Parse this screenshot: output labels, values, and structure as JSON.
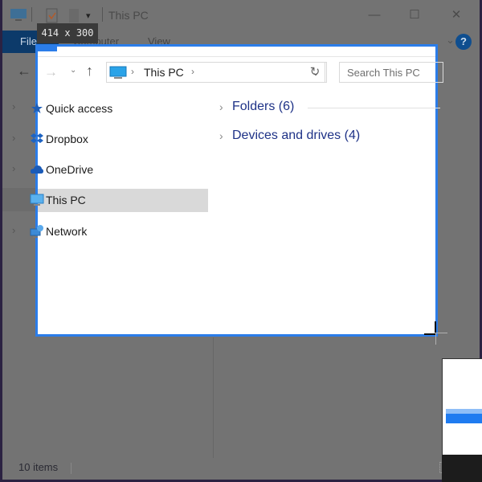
{
  "window": {
    "title": "This PC",
    "controls": {
      "minimize": "—",
      "maximize": "☐",
      "close": "✕"
    }
  },
  "ribbon": {
    "tabs": [
      "File",
      "Computer",
      "View"
    ],
    "help": "?"
  },
  "size_tooltip": "414 x 300",
  "address_bar": {
    "path": "This PC",
    "separator": "›",
    "dropdown": "⌄",
    "refresh": "↻"
  },
  "nav": {
    "back": "←",
    "forward": "→",
    "recent": "⌄",
    "up": "↑"
  },
  "search": {
    "placeholder": "Search This PC"
  },
  "sidebar": {
    "expand_glyph": "›",
    "items": [
      {
        "label": "Quick access",
        "icon": "star-icon"
      },
      {
        "label": "Dropbox",
        "icon": "dropbox-icon"
      },
      {
        "label": "OneDrive",
        "icon": "cloud-icon"
      },
      {
        "label": "This PC",
        "icon": "computer-icon",
        "selected": true
      },
      {
        "label": "Network",
        "icon": "network-icon"
      }
    ]
  },
  "content": {
    "groups": [
      {
        "label": "Folders (6)"
      },
      {
        "label": "Devices and drives (4)"
      }
    ]
  },
  "status_bar": {
    "items_count": "10 items"
  },
  "colors": {
    "accent": "#2b7de9",
    "group_heading": "#1e3287",
    "selected_row": "#d9d9d9",
    "dim_overlay": "#737373"
  }
}
